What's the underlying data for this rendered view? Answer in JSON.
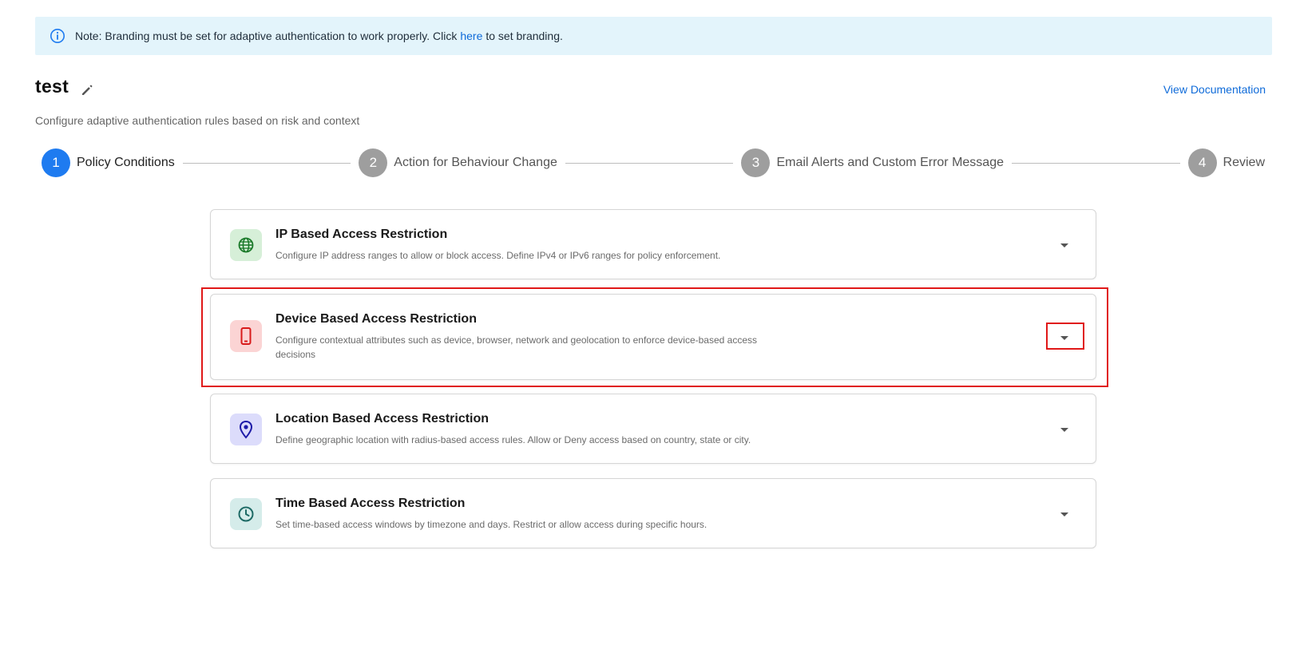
{
  "banner": {
    "prefix": "Note: Branding must be set for adaptive authentication to work properly. Click",
    "link": "here",
    "suffix": "to set branding."
  },
  "page": {
    "title": "test",
    "subtitle": "Configure adaptive authentication rules based on risk and context",
    "doc_link": "View Documentation"
  },
  "steps": [
    {
      "number": "1",
      "label": "Policy Conditions",
      "state": "active"
    },
    {
      "number": "2",
      "label": "Action for Behaviour Change",
      "state": "inactive"
    },
    {
      "number": "3",
      "label": "Email Alerts and Custom Error Message",
      "state": "inactive"
    },
    {
      "number": "4",
      "label": "Review",
      "state": "inactive"
    }
  ],
  "cards": [
    {
      "title": "IP Based Access Restriction",
      "description": "Configure IP address ranges to allow or block access. Define IPv4 or IPv6 ranges for policy enforcement.",
      "icon": "globe-icon",
      "icon_bg": "#d6efd8",
      "icon_color": "#1b7a2a"
    },
    {
      "title": "Device Based Access Restriction",
      "description": "Configure contextual attributes such as device, browser, network and geolocation to enforce device-based access decisions",
      "icon": "mobile-phone-icon",
      "icon_bg": "#fbd4d4",
      "icon_color": "#d81b1b"
    },
    {
      "title": "Location Based Access Restriction",
      "description": "Define geographic location with radius-based access rules. Allow or Deny access based on country, state or city.",
      "icon": "location-pin-icon",
      "icon_bg": "#dcdcfb",
      "icon_color": "#1d1ba8"
    },
    {
      "title": "Time Based Access Restriction",
      "description": "Set time-based access windows by timezone and days. Restrict or allow access during specific hours.",
      "icon": "clock-icon",
      "icon_bg": "#d5ecea",
      "icon_color": "#1e6b66"
    }
  ],
  "colors": {
    "accent": "#1e7bf0",
    "link": "#0f6bd9",
    "banner_bg": "#e3f4fb",
    "highlight": "#e01818"
  }
}
